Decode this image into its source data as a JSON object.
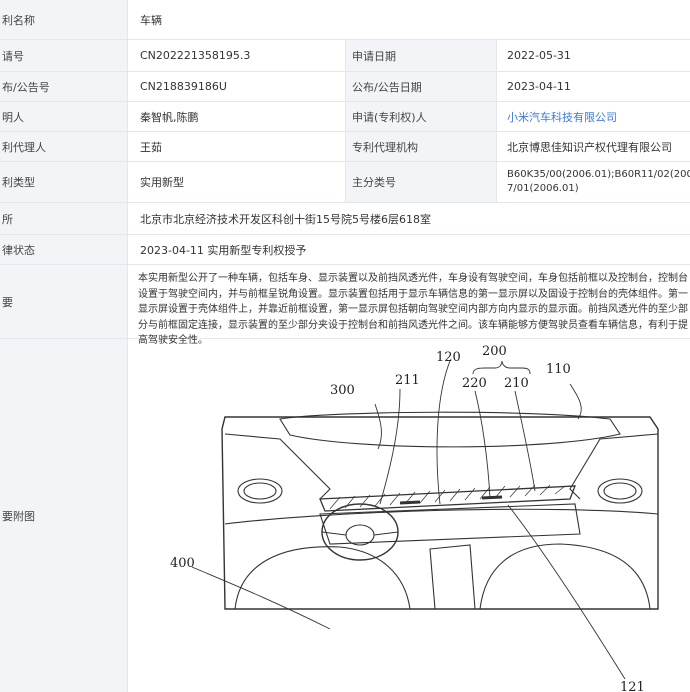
{
  "rows": {
    "title": {
      "label": "利名称",
      "value": "车辆"
    },
    "app_no": {
      "label": "请号",
      "value": "CN202221358195.3",
      "label2": "申请日期",
      "value2": "2022-05-31"
    },
    "pub_no": {
      "label": "布/公告号",
      "value": "CN218839186U",
      "label2": "公布/公告日期",
      "value2": "2023-04-11"
    },
    "inventor": {
      "label": "明人",
      "value": "秦智帆,陈鹏",
      "label2": "申请(专利权)人",
      "value2": "小米汽车科技有限公司"
    },
    "agent": {
      "label": "利代理人",
      "value": "王茹",
      "label2": "专利代理机构",
      "value2": "北京博思佳知识产权代理有限公司"
    },
    "type": {
      "label": "利类型",
      "value": "实用新型",
      "label2": "主分类号",
      "value2_line1": "B60K35/00(2006.01);B60R11/02(2006.01);G028",
      "value2_line2": "7/01(2006.01)"
    },
    "address": {
      "label": "所",
      "value": "北京市北京经济技术开发区科创十街15号院5号楼6层618室"
    },
    "status": {
      "label": "律状态",
      "value": "2023-04-11 实用新型专利权授予"
    },
    "abstract": {
      "label": "要",
      "value": "本实用新型公开了一种车辆，包括车身、显示装置以及前挡风透光件，车身设有驾驶空间，车身包括前框以及控制台，控制台设置于驾驶空间内，并与前框呈锐角设置。显示装置包括用于显示车辆信息的第一显示屏以及固设于控制台的壳体组件。第一显示屏设置于壳体组件上，并靠近前框设置，第一显示屏包括朝向驾驶空间内部方向内显示的显示面。前挡风透光件的至少部分与前框固定连接，显示装置的至少部分夹设于控制台和前挡风透光件之间。该车辆能够方便驾驶员查看车辆信息，有利于提高驾驶安全性。"
    },
    "figure": {
      "label": "要附图"
    }
  },
  "figure_labels": {
    "n300": "300",
    "n211": "211",
    "n120": "120",
    "n200": "200",
    "n220": "220",
    "n210": "210",
    "n110": "110",
    "n400": "400",
    "n121": "121"
  }
}
